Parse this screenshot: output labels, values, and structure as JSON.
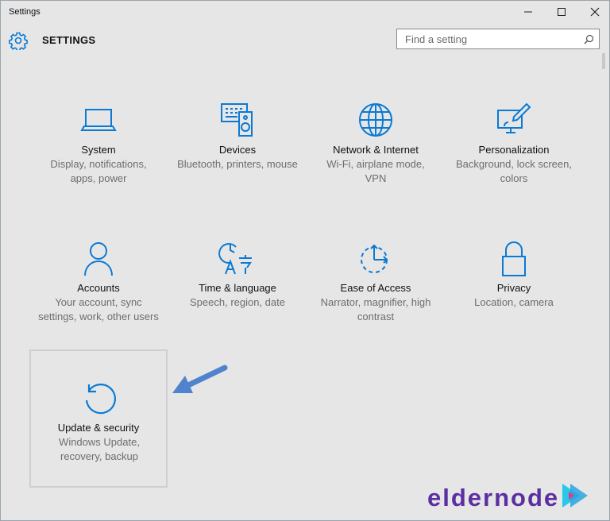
{
  "window": {
    "title": "Settings"
  },
  "header": {
    "title": "SETTINGS",
    "search_placeholder": "Find a setting"
  },
  "colors": {
    "accent": "#0a7ad4",
    "arrow": "#4f84cc",
    "logo": "#5b2fa1",
    "logo_play": "#27c8e8"
  },
  "tiles": [
    {
      "title": "System",
      "desc": "Display, notifications, apps, power",
      "icon": "laptop-icon"
    },
    {
      "title": "Devices",
      "desc": "Bluetooth, printers, mouse",
      "icon": "devices-icon"
    },
    {
      "title": "Network & Internet",
      "desc": "Wi-Fi, airplane mode, VPN",
      "icon": "globe-icon"
    },
    {
      "title": "Personalization",
      "desc": "Background, lock screen, colors",
      "icon": "paintbrush-icon"
    },
    {
      "title": "Accounts",
      "desc": "Your account, sync settings, work, other users",
      "icon": "person-icon"
    },
    {
      "title": "Time & language",
      "desc": "Speech, region, date",
      "icon": "time-language-icon"
    },
    {
      "title": "Ease of Access",
      "desc": "Narrator, magnifier, high contrast",
      "icon": "ease-of-access-icon"
    },
    {
      "title": "Privacy",
      "desc": "Location, camera",
      "icon": "lock-icon"
    },
    {
      "title": "Update & security",
      "desc": "Windows Update, recovery, backup",
      "icon": "update-icon"
    }
  ],
  "watermark": {
    "text": "eldernode"
  }
}
